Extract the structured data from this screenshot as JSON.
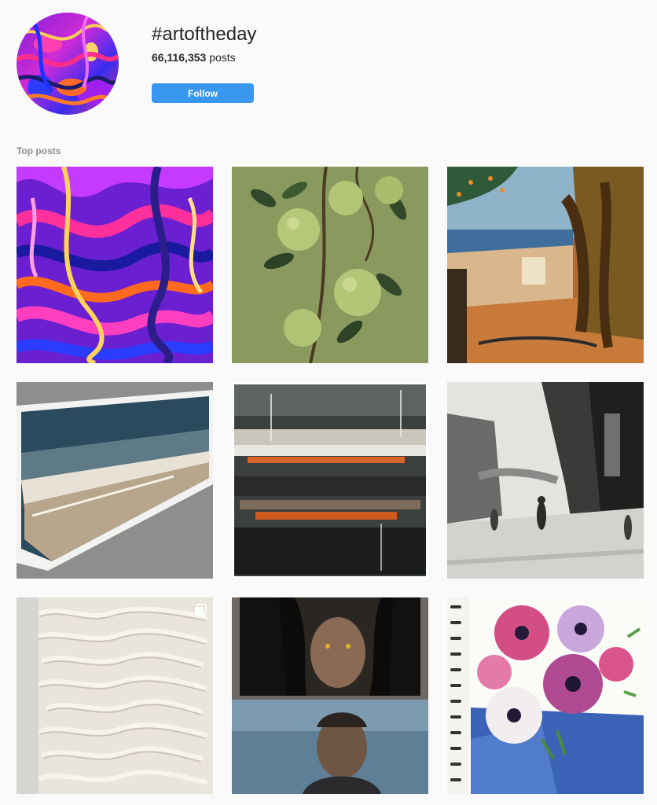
{
  "hashtag": {
    "title": "#artoftheday",
    "post_count": "66,116,353",
    "post_label": "posts",
    "follow_label": "Follow"
  },
  "sections": {
    "top_posts_label": "Top posts"
  },
  "posts": [
    {
      "name": "post-abstract-fluid",
      "subject": "abstract colorful fluid painting"
    },
    {
      "name": "post-green-apples",
      "subject": "green apples on branch"
    },
    {
      "name": "post-mediterranean-landscape",
      "subject": "mediterranean landscape painting"
    },
    {
      "name": "post-framed-seascape",
      "subject": "framed seascape canvas"
    },
    {
      "name": "post-abstract-horizon",
      "subject": "abstract horizon painting"
    },
    {
      "name": "post-street-watercolor",
      "subject": "city street watercolor"
    },
    {
      "name": "post-calligraphy-relief",
      "subject": "white calligraphy relief",
      "multi": true
    },
    {
      "name": "post-portrait-collage",
      "subject": "hooded portrait and man"
    },
    {
      "name": "post-anemone-flowers",
      "subject": "anemone flowers watercolor sketchbook"
    }
  ],
  "colors": {
    "follow_button": "#3897f0",
    "background": "#fafafa",
    "muted_text": "#8e8e8e"
  }
}
